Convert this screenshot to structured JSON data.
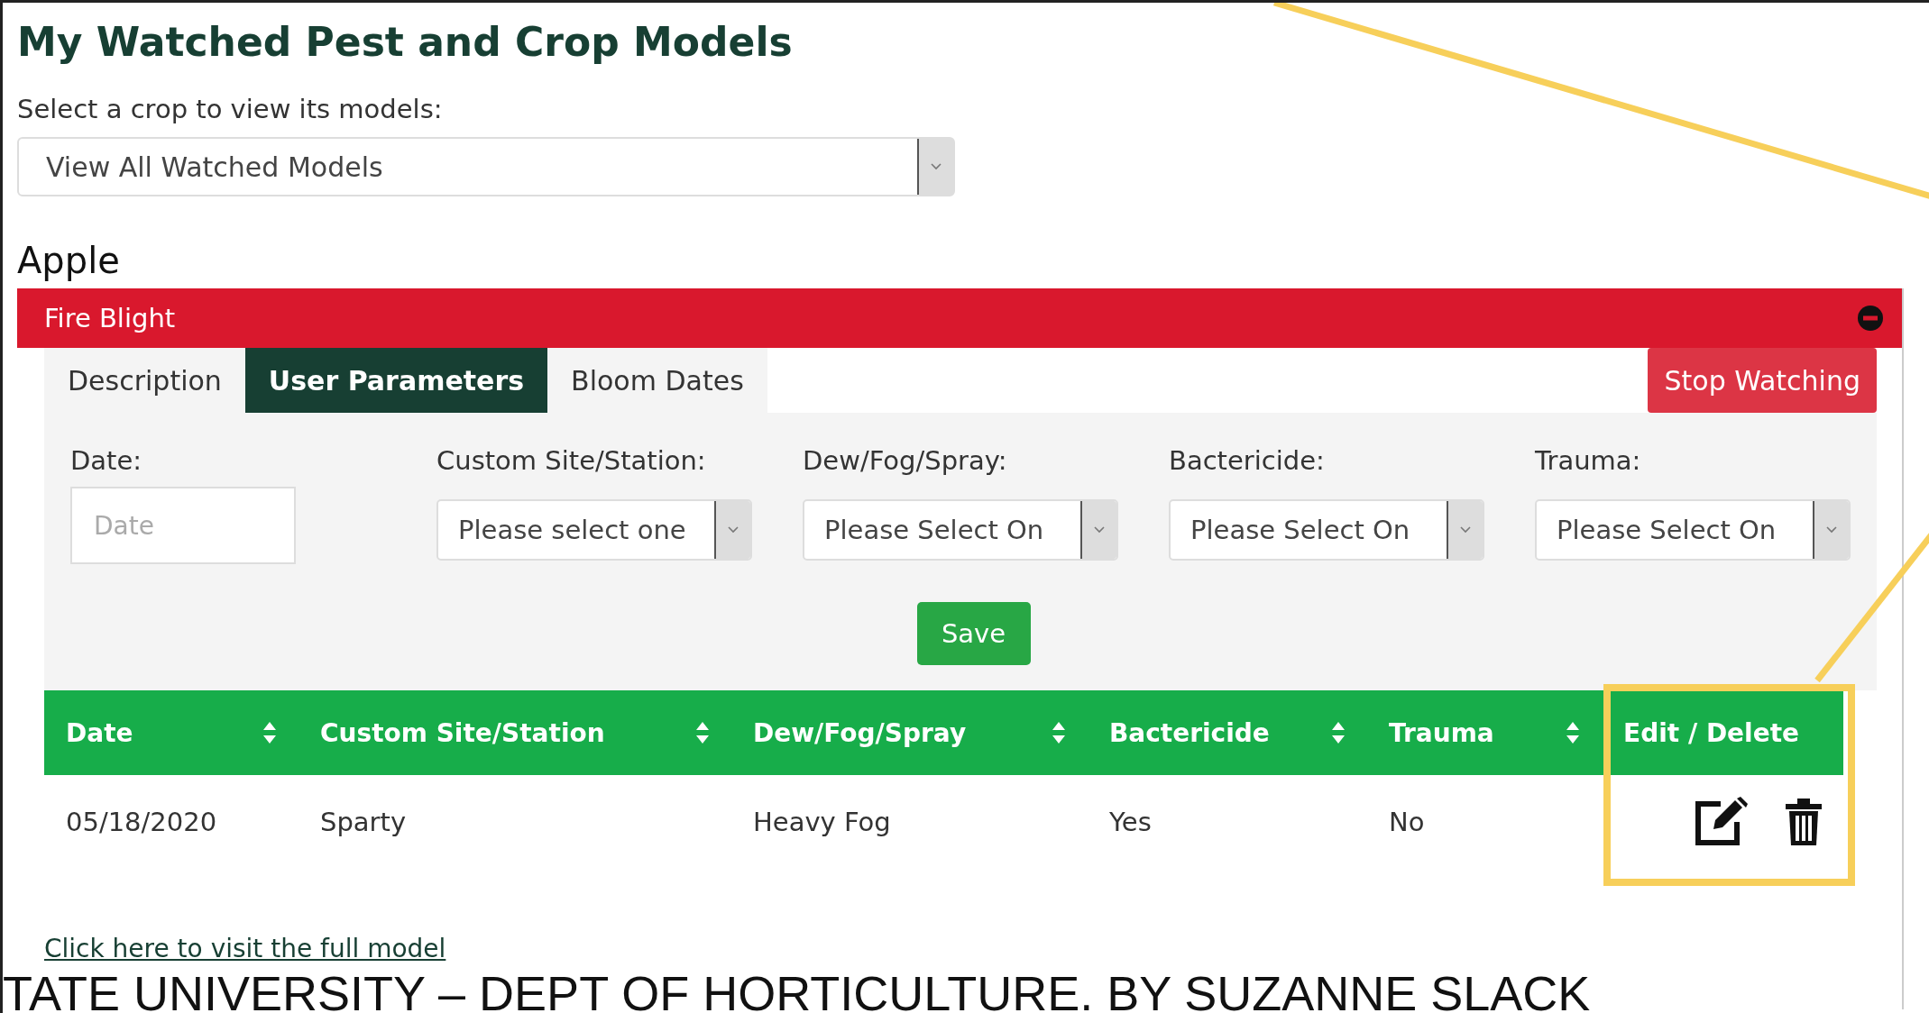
{
  "page_title": "My Watched Pest and Crop Models",
  "crop_select": {
    "label": "Select a crop to view its models:",
    "value": "View All Watched Models"
  },
  "crop_heading": "Apple",
  "model": {
    "name": "Fire Blight"
  },
  "tabs": [
    {
      "label": "Description",
      "selected": false
    },
    {
      "label": "User Parameters",
      "selected": true
    },
    {
      "label": "Bloom Dates",
      "selected": false
    }
  ],
  "stop_button": "Stop Watching",
  "params": [
    {
      "kind": "text",
      "label": "Date:",
      "placeholder": "Date"
    },
    {
      "kind": "select",
      "label": "Custom Site/Station:",
      "value": "Please select one"
    },
    {
      "kind": "select",
      "label": "Dew/Fog/Spray:",
      "value": "Please Select On"
    },
    {
      "kind": "select",
      "label": "Bactericide:",
      "value": "Please Select On"
    },
    {
      "kind": "select",
      "label": "Trauma:",
      "value": "Please Select On"
    }
  ],
  "save_button": "Save",
  "table": {
    "columns": [
      {
        "label": "Date",
        "sortable": true
      },
      {
        "label": "Custom Site/Station",
        "sortable": true
      },
      {
        "label": "Dew/Fog/Spray",
        "sortable": true
      },
      {
        "label": "Bactericide",
        "sortable": true
      },
      {
        "label": "Trauma",
        "sortable": true
      },
      {
        "label": "Edit / Delete",
        "sortable": false
      }
    ],
    "rows": [
      {
        "cells": [
          "05/18/2020",
          "Sparty",
          "Heavy Fog",
          "Yes",
          "No"
        ]
      }
    ]
  },
  "link": "Click here to visit the full model",
  "footer": "TATE UNIVERSITY – DEPT OF HORTICULTURE. BY SUZANNE SLACK"
}
